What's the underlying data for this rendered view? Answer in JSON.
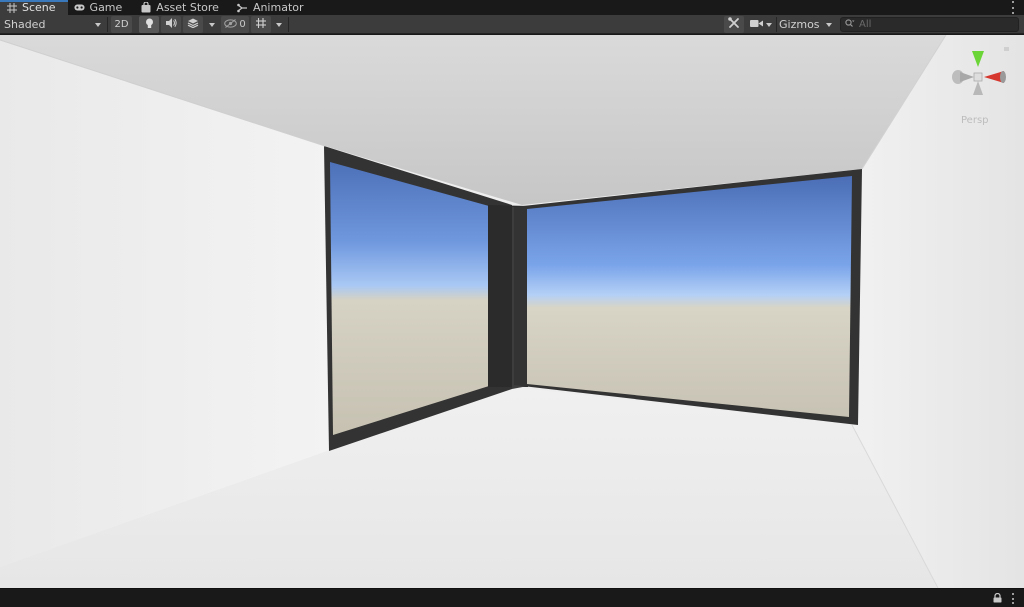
{
  "tabs": [
    {
      "label": "Scene",
      "icon": "grid-icon",
      "active": true
    },
    {
      "label": "Game",
      "icon": "gamepad-icon",
      "active": false
    },
    {
      "label": "Asset Store",
      "icon": "shopping-bag-icon",
      "active": false
    },
    {
      "label": "Animator",
      "icon": "animator-icon",
      "active": false
    }
  ],
  "toolbar": {
    "draw_mode": "Shaded",
    "mode_2d": "2D",
    "hidden_count": "0",
    "gizmos_label": "Gizmos",
    "search_placeholder": "All"
  },
  "scene_gizmo": {
    "projection_label": "Persp",
    "axes": [
      "y-axis-green",
      "x-axis-red",
      "z-axis-blue"
    ]
  },
  "colors": {
    "active_tab_accent": "#3a79bb",
    "panel_bg": "#3c3c3c",
    "dark_bg": "#191919",
    "gizmo_y": "#6bd437",
    "gizmo_x": "#d6382f"
  }
}
